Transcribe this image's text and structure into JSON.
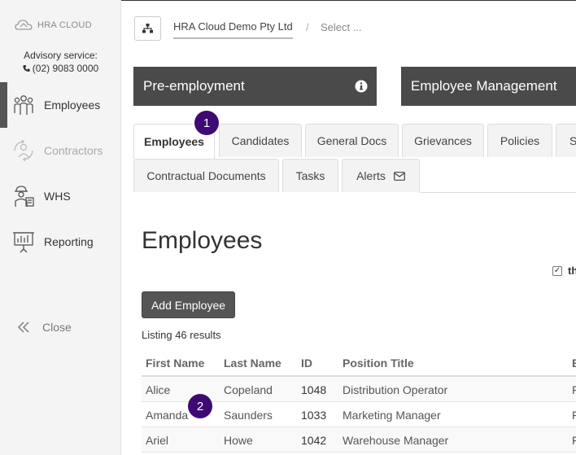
{
  "sidebar": {
    "logo_text": "HRA CLOUD",
    "advisory_label": "Advisory service:",
    "advisory_phone": "(02) 9083 0000",
    "items": [
      {
        "label": "Employees",
        "icon": "people-icon"
      },
      {
        "label": "Contractors",
        "icon": "contractors-icon"
      },
      {
        "label": "WHS",
        "icon": "worker-icon"
      },
      {
        "label": "Reporting",
        "icon": "presentation-chart-icon"
      }
    ],
    "close_label": "Close"
  },
  "topbar": {
    "org_name": "HRA Cloud Demo Pty Ltd",
    "separator": "/",
    "select_placeholder": "Select ..."
  },
  "cards": {
    "pre_employment": "Pre-employment",
    "employee_management": "Employee Management"
  },
  "tabs": {
    "row1": [
      "Employees",
      "Candidates",
      "General Docs",
      "Grievances",
      "Policies",
      "S"
    ],
    "row2": [
      "Contractual Documents",
      "Tasks",
      "Alerts"
    ]
  },
  "badges": [
    "1",
    "2"
  ],
  "main": {
    "title": "Employees",
    "checkbox_label": "th",
    "add_button": "Add Employee",
    "listing": "Listing 46 results"
  },
  "table": {
    "headers": [
      "First Name",
      "Last Name",
      "ID",
      "Position Title",
      "E"
    ],
    "rows": [
      [
        "Alice",
        "Copeland",
        "1048",
        "Distribution Operator",
        "F"
      ],
      [
        "Amanda",
        "Saunders",
        "1033",
        "Marketing Manager",
        "F"
      ],
      [
        "Ariel",
        "Howe",
        "1042",
        "Warehouse Manager",
        "F"
      ]
    ]
  },
  "colors": {
    "accent_dark": "#4a4a4a",
    "badge": "#3d0a73"
  }
}
